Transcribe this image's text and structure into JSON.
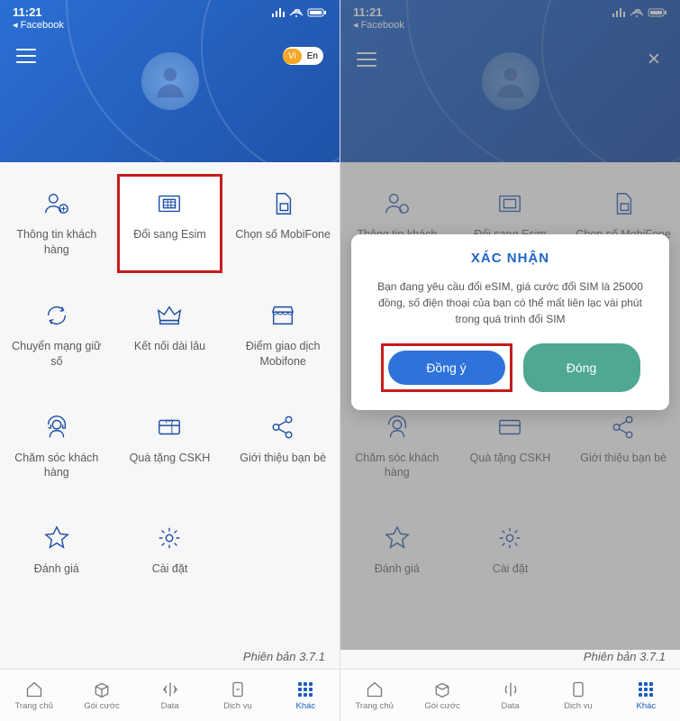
{
  "status": {
    "time": "11:21",
    "back": "◂ Facebook"
  },
  "lang": {
    "vi": "Vi",
    "en": "En"
  },
  "grid": {
    "customer_info": "Thông tin khách hàng",
    "esim": "Đổi sang Esim",
    "choose_number": "Chọn số MobiFone",
    "mnp": "Chuyển mạng giữ số",
    "connect": "Kết nối dài lâu",
    "transaction_point": "Điểm giao dịch Mobifone",
    "care": "Chăm sóc khách hàng",
    "gift": "Quà tặng CSKH",
    "refer": "Giới thiệu bạn bè",
    "rate": "Đánh giá",
    "settings": "Cài đặt"
  },
  "version": "Phiên bản 3.7.1",
  "tabs": {
    "home": "Trang chủ",
    "package": "Gói cước",
    "data": "Data",
    "service": "Dịch vụ",
    "other": "Khác"
  },
  "dialog": {
    "title": "XÁC NHẬN",
    "body": "Bạn đang yêu cầu đổi eSIM, giá cước đổi SIM là 25000 đồng, số điện thoại của bạn có thể mất liên lạc vài phút trong quá trình đổi SIM",
    "agree": "Đồng ý",
    "close": "Đóng"
  }
}
